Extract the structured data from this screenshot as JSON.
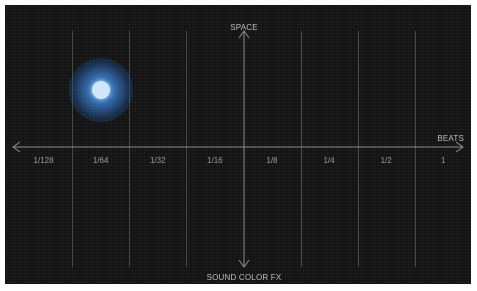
{
  "pad": {
    "top_label": "SPACE",
    "bottom_label": "SOUND COLOR FX",
    "right_label": "BEATS",
    "beat_values": [
      "1/128",
      "1/64",
      "1/32",
      "1/16",
      "1/8",
      "1/4",
      "1/2",
      "1"
    ],
    "touch_position": {
      "beat": "1/64",
      "space_level": 0.75
    },
    "colors": {
      "background": "#141414",
      "grid": "#4a4a4a",
      "axis": "#8c8c8c",
      "touch": "#5aa0e6"
    }
  }
}
